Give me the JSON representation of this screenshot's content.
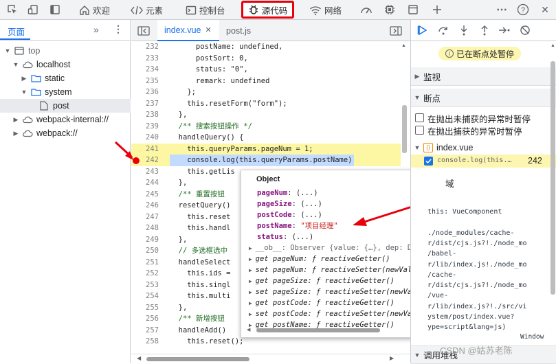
{
  "toolbar": {
    "tabs": [
      {
        "label": "欢迎",
        "icon": "home-icon"
      },
      {
        "label": "元素",
        "icon": "code-brackets-icon"
      },
      {
        "label": "控制台",
        "icon": "console-icon"
      },
      {
        "label": "源代码",
        "icon": "bug-icon"
      },
      {
        "label": "网络",
        "icon": "wifi-icon"
      }
    ],
    "help": "?",
    "close": "✕"
  },
  "navigator": {
    "tab_label": "页面",
    "tree": [
      {
        "label": "top",
        "type": "window"
      },
      {
        "label": "localhost",
        "type": "cloud"
      },
      {
        "label": "static",
        "type": "folder"
      },
      {
        "label": "system",
        "type": "folder"
      },
      {
        "label": "post",
        "type": "file"
      },
      {
        "label": "webpack-internal://",
        "type": "cloud"
      },
      {
        "label": "webpack://",
        "type": "cloud"
      }
    ]
  },
  "editor": {
    "tabs": [
      {
        "label": "index.vue",
        "active": true
      },
      {
        "label": "post.js",
        "active": false
      }
    ],
    "lines": [
      {
        "n": "232",
        "text": "      postName: undefined,"
      },
      {
        "n": "233",
        "text": "      postSort: 0,"
      },
      {
        "n": "234",
        "text": "      status: \"0\","
      },
      {
        "n": "235",
        "text": "      remark: undefined"
      },
      {
        "n": "236",
        "text": "    };"
      },
      {
        "n": "237",
        "text": "    this.resetForm(\"form\");"
      },
      {
        "n": "238",
        "text": "  },"
      },
      {
        "n": "239",
        "text": "  /** 搜索按钮操作 */"
      },
      {
        "n": "240",
        "text": "  handleQuery() {"
      },
      {
        "n": "241",
        "text": "    this.queryParams.pageNum = 1;"
      },
      {
        "n": "242",
        "text": "    console.log(this.queryParams.postName)"
      },
      {
        "n": "243",
        "text": "    this.getLis"
      },
      {
        "n": "244",
        "text": "  },"
      },
      {
        "n": "245",
        "text": "  /** 重置按钮"
      },
      {
        "n": "246",
        "text": "  resetQuery()"
      },
      {
        "n": "247",
        "text": "    this.reset"
      },
      {
        "n": "248",
        "text": "    this.handl"
      },
      {
        "n": "249",
        "text": "  },"
      },
      {
        "n": "250",
        "text": "  // 多选框选中"
      },
      {
        "n": "251",
        "text": "  handleSelect"
      },
      {
        "n": "252",
        "text": "    this.ids ="
      },
      {
        "n": "253",
        "text": "    this.singl"
      },
      {
        "n": "254",
        "text": "    this.multi"
      },
      {
        "n": "255",
        "text": "  },"
      },
      {
        "n": "256",
        "text": "  /** 新增按钮"
      },
      {
        "n": "257",
        "text": "  handleAdd()"
      },
      {
        "n": "258",
        "text": "    this.reset();"
      }
    ]
  },
  "tooltip": {
    "title": "Object",
    "rows": [
      {
        "key": "pageNum",
        "value": "(...)"
      },
      {
        "key": "pageSize",
        "value": "(...)"
      },
      {
        "key": "postCode",
        "value": "(...)"
      },
      {
        "key": "postName",
        "value": "\"项目经理\""
      },
      {
        "key": "status",
        "value": "(...)"
      }
    ],
    "ob_row": "__ob__: Observer {value: {…}, dep: Dep,",
    "getters": [
      "get pageNum: ƒ reactiveGetter()",
      "set pageNum: ƒ reactiveSetter(newVal)",
      "get pageSize: ƒ reactiveGetter()",
      "set pageSize: ƒ reactiveSetter(newVal)",
      "get postCode: ƒ reactiveGetter()",
      "set postCode: ƒ reactiveSetter(newVal)",
      "get postName: ƒ reactiveGetter()"
    ]
  },
  "debugger": {
    "paused_label": "已在断点处暂停",
    "watch_label": "监视",
    "breakpoints_label": "断点",
    "uncaught_label": "在抛出未捕获的异常时暂停",
    "caught_label": "在抛出捕获的异常时暂停",
    "bp_file": "index.vue",
    "bp_code": "console.log(this.…",
    "bp_line": "242",
    "scope_partial": "域",
    "scope_lines": [
      "this: VueComponent",
      "",
      "./node_modules/cache-",
      "r/dist/cjs.js?!./node_mo",
      "/babel-",
      "r/lib/index.js!./node_mo",
      "/cache-",
      "r/dist/cjs.js?!./node_mo",
      "/vue-",
      "r/lib/index.js?!./src/vi",
      "ystem/post/index.vue?",
      "ype=script&lang=js)"
    ],
    "window_label": "Window",
    "callstack_label": "调用堆栈"
  },
  "watermark": "CSDN @姑苏老陈"
}
